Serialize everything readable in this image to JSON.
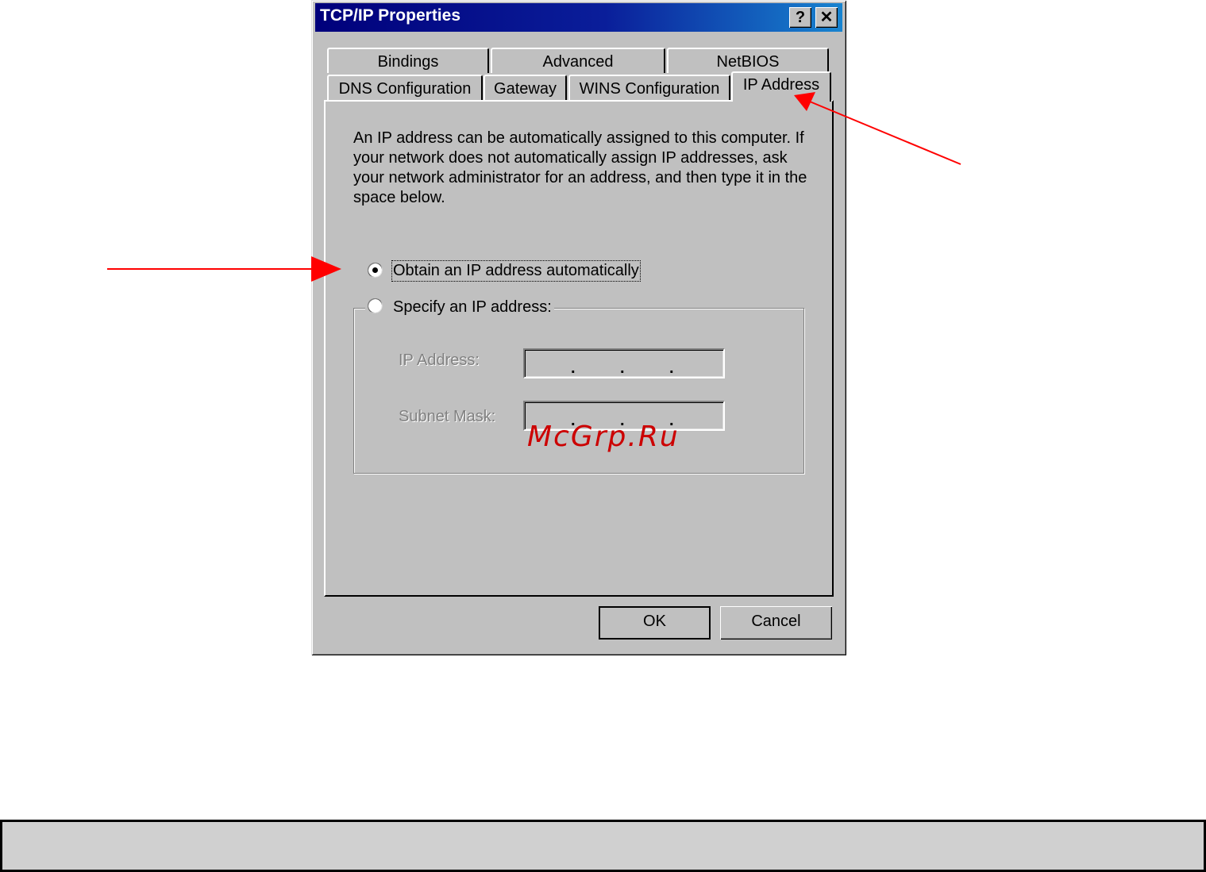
{
  "window": {
    "title": "TCP/IP Properties",
    "help_label": "?",
    "close_label": "✕"
  },
  "tabs": {
    "row1": [
      "Bindings",
      "Advanced",
      "NetBIOS"
    ],
    "row2": [
      "DNS Configuration",
      "Gateway",
      "WINS Configuration",
      "IP Address"
    ],
    "active": "IP Address"
  },
  "panel": {
    "description": "An IP address can be automatically assigned to this computer. If your network does not automatically assign IP addresses, ask your network administrator for an address, and then type it in the space below.",
    "option_auto": "Obtain an IP address automatically",
    "option_specify": "Specify an IP address:",
    "option_auto_selected": true,
    "ip_address_label": "IP Address:",
    "subnet_mask_label": "Subnet Mask:",
    "ip_dot": "."
  },
  "buttons": {
    "ok": "OK",
    "cancel": "Cancel"
  },
  "watermark": "McGrp.Ru",
  "colors": {
    "annotation_arrow": "#ff0000",
    "titlebar_start": "#00007b",
    "titlebar_end": "#1884d0",
    "dialog_face": "#c0c0c0"
  }
}
